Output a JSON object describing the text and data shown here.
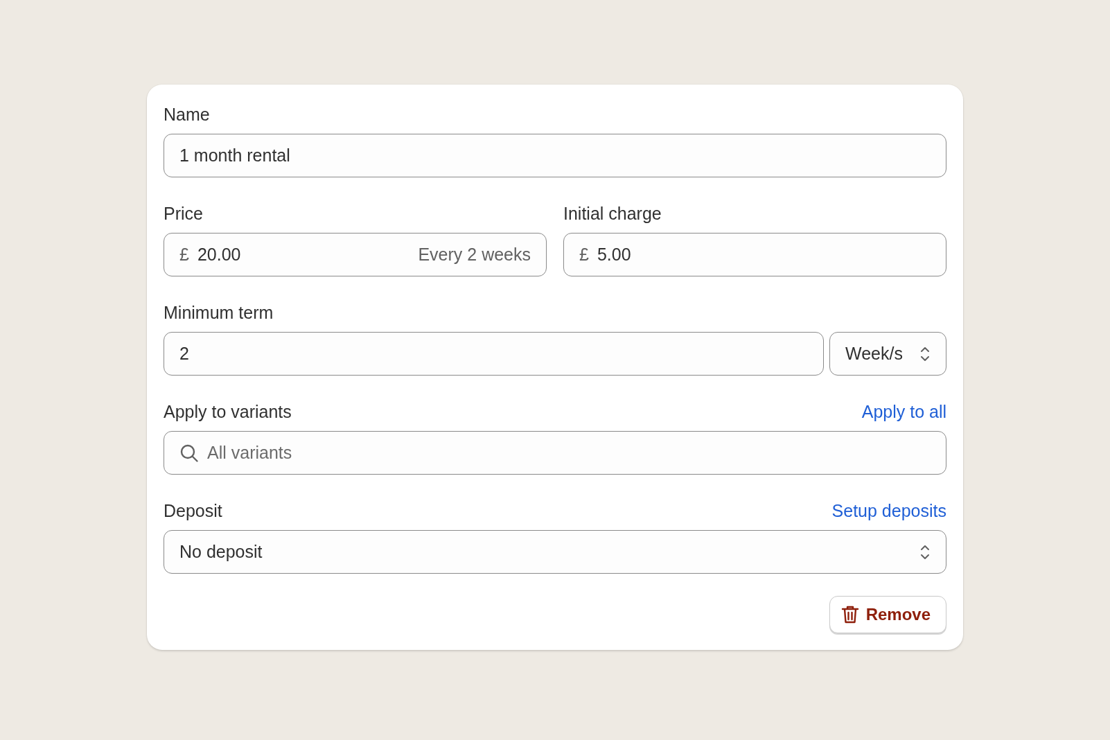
{
  "name": {
    "label": "Name",
    "value": "1 month rental"
  },
  "price": {
    "label": "Price",
    "currency": "£",
    "value": "20.00",
    "suffix": "Every 2 weeks"
  },
  "initial_charge": {
    "label": "Initial charge",
    "currency": "£",
    "value": "5.00"
  },
  "minimum_term": {
    "label": "Minimum term",
    "value": "2",
    "unit": "Week/s"
  },
  "variants": {
    "label": "Apply to variants",
    "link": "Apply to all",
    "placeholder": "All variants"
  },
  "deposit": {
    "label": "Deposit",
    "link": "Setup deposits",
    "value": "No deposit"
  },
  "remove_button": {
    "label": "Remove"
  }
}
